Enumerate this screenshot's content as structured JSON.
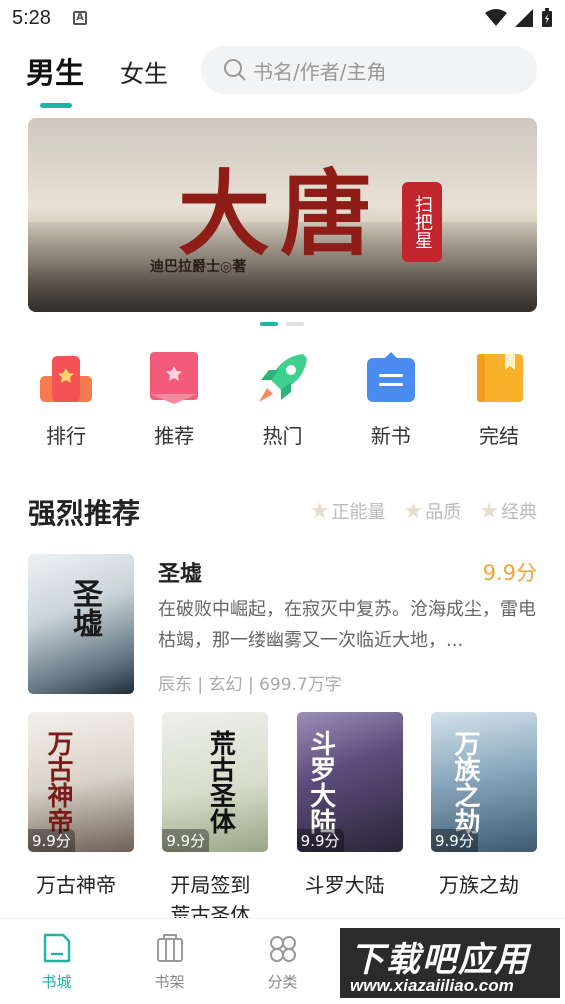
{
  "status_bar": {
    "time": "5:28",
    "notification_icon": "a-icon"
  },
  "header": {
    "tab_male": "男生",
    "tab_female": "女生",
    "search_placeholder": "书名/作者/主角"
  },
  "banner": {
    "title": "大唐",
    "seal": "扫把星",
    "author": "迪巴拉爵士◎著",
    "active_index": 0,
    "count": 2
  },
  "categories": [
    {
      "label": "排行",
      "icon": "ranking-icon"
    },
    {
      "label": "推荐",
      "icon": "recommend-icon"
    },
    {
      "label": "热门",
      "icon": "rocket-icon"
    },
    {
      "label": "新书",
      "icon": "new-book-icon"
    },
    {
      "label": "完结",
      "icon": "finished-book-icon"
    }
  ],
  "section": {
    "title": "强烈推荐",
    "filters": [
      "正能量",
      "品质",
      "经典"
    ]
  },
  "featured": {
    "name": "圣墟",
    "score": "9.9分",
    "cover_text": "圣墟",
    "description": "在破败中崛起，在寂灭中复苏。沧海成尘，雷电枯竭，那一缕幽雾又一次临近大地，...",
    "meta": "辰东 | 玄幻 | 699.7万字"
  },
  "books": [
    {
      "name": "万古神帝",
      "score": "9.9分",
      "cover_text": "万古神帝"
    },
    {
      "name": "开局签到荒古圣体",
      "score": "9.9分",
      "cover_text": "荒古圣体"
    },
    {
      "name": "斗罗大陆",
      "score": "9.9分",
      "cover_text": "斗罗大陆"
    },
    {
      "name": "万族之劫",
      "score": "9.9分",
      "cover_text": "万族之劫"
    }
  ],
  "nav": [
    {
      "label": "书城",
      "icon": "bookstore-icon",
      "active": true
    },
    {
      "label": "书架",
      "icon": "bookshelf-icon",
      "active": false
    },
    {
      "label": "分类",
      "icon": "category-icon",
      "active": false
    }
  ],
  "watermark": {
    "line1": "下载吧应用",
    "line2": "www.xiazaiiliao.com"
  },
  "colors": {
    "accent": "#1fb3a4",
    "score": "#f0a43a"
  }
}
